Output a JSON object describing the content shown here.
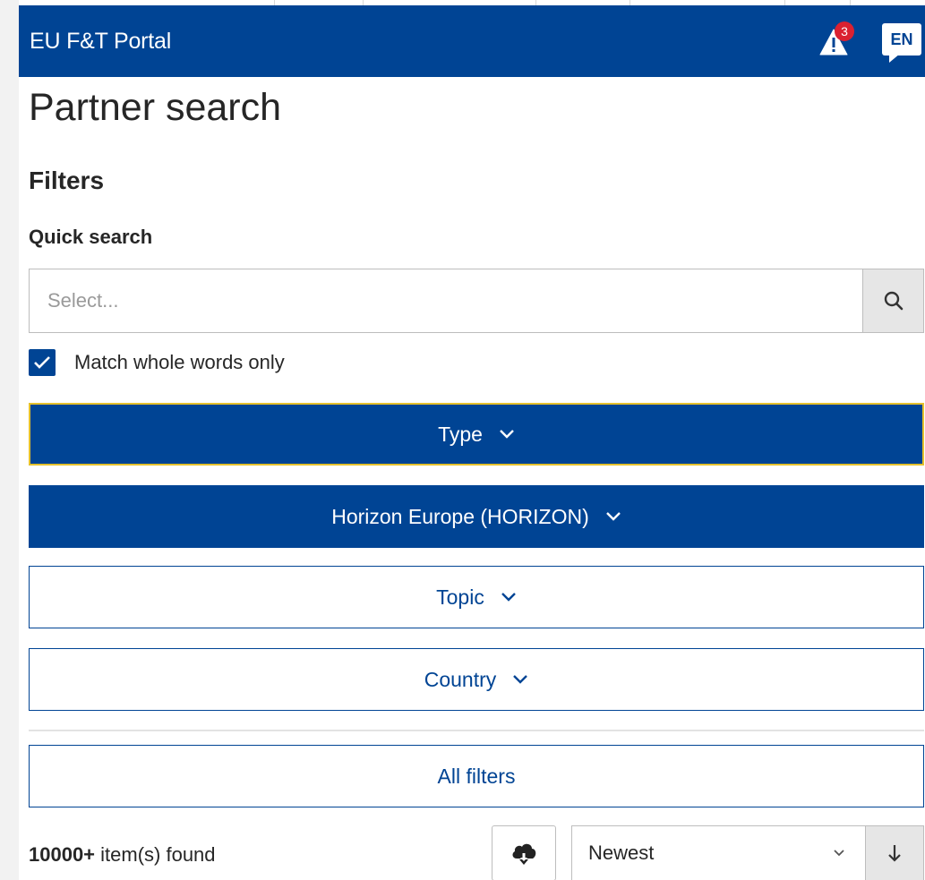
{
  "header": {
    "brand": "EU F&T Portal",
    "alert_count": "3",
    "language": "EN",
    "background": "#004494"
  },
  "page": {
    "title": "Partner search"
  },
  "filters": {
    "title": "Filters",
    "quick_search_label": "Quick search",
    "search_placeholder": "Select...",
    "match_whole_words_label": "Match whole words only",
    "match_whole_words_checked": true,
    "buttons": [
      {
        "label": "Type",
        "style": "primary",
        "focused": true
      },
      {
        "label": "Horizon Europe (HORIZON)",
        "style": "primary",
        "focused": false
      },
      {
        "label": "Topic",
        "style": "secondary",
        "focused": false
      },
      {
        "label": "Country",
        "style": "secondary",
        "focused": false
      }
    ],
    "all_filters_label": "All filters"
  },
  "results": {
    "count": "10000+",
    "count_suffix": " item(s) found",
    "sort_value": "Newest"
  },
  "colors": {
    "primary": "#004494",
    "badge": "#da2131",
    "focus_outline": "#e5c12d"
  },
  "icons": {
    "alert": "warning-triangle-icon",
    "language": "speech-bubble-icon",
    "search": "magnifier-icon",
    "download": "cloud-download-icon",
    "sort_direction": "arrow-down-icon"
  }
}
